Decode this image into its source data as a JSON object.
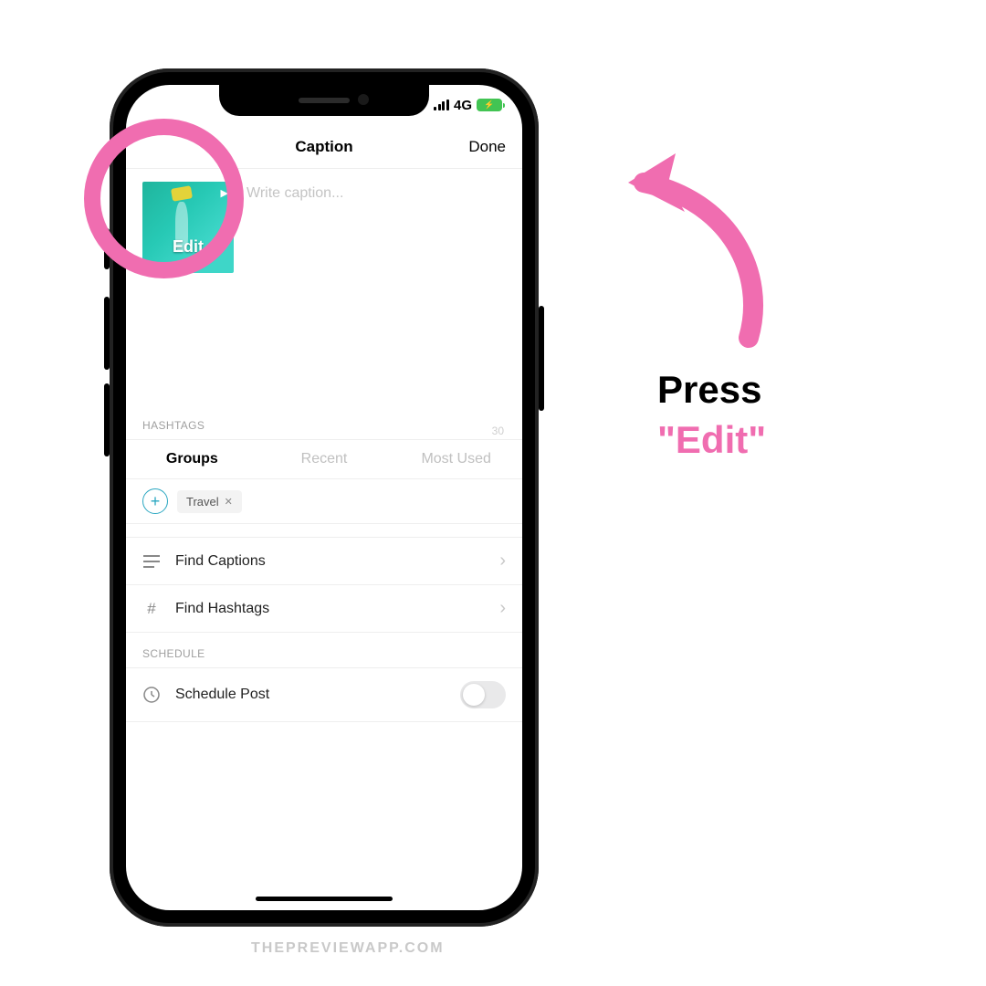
{
  "colors": {
    "accent_pink": "#f06db0",
    "teal": "#2aa7c1",
    "green_battery": "#42c453"
  },
  "status_bar": {
    "network_label": "4G"
  },
  "nav": {
    "title": "Caption",
    "done": "Done"
  },
  "caption": {
    "placeholder": "Write caption...",
    "thumb_overlay": "Edit",
    "char_count": "30"
  },
  "hashtags": {
    "section_label": "HASHTAGS",
    "tabs": {
      "groups": "Groups",
      "recent": "Recent",
      "most_used": "Most Used"
    },
    "chip": "Travel"
  },
  "rows": {
    "find_captions": "Find Captions",
    "find_hashtags": "Find Hashtags"
  },
  "schedule": {
    "section_label": "SCHEDULE",
    "schedule_post": "Schedule Post"
  },
  "annotation": {
    "line1": "Press",
    "line2": "\"Edit\""
  },
  "watermark": "THEPREVIEWAPP.COM"
}
